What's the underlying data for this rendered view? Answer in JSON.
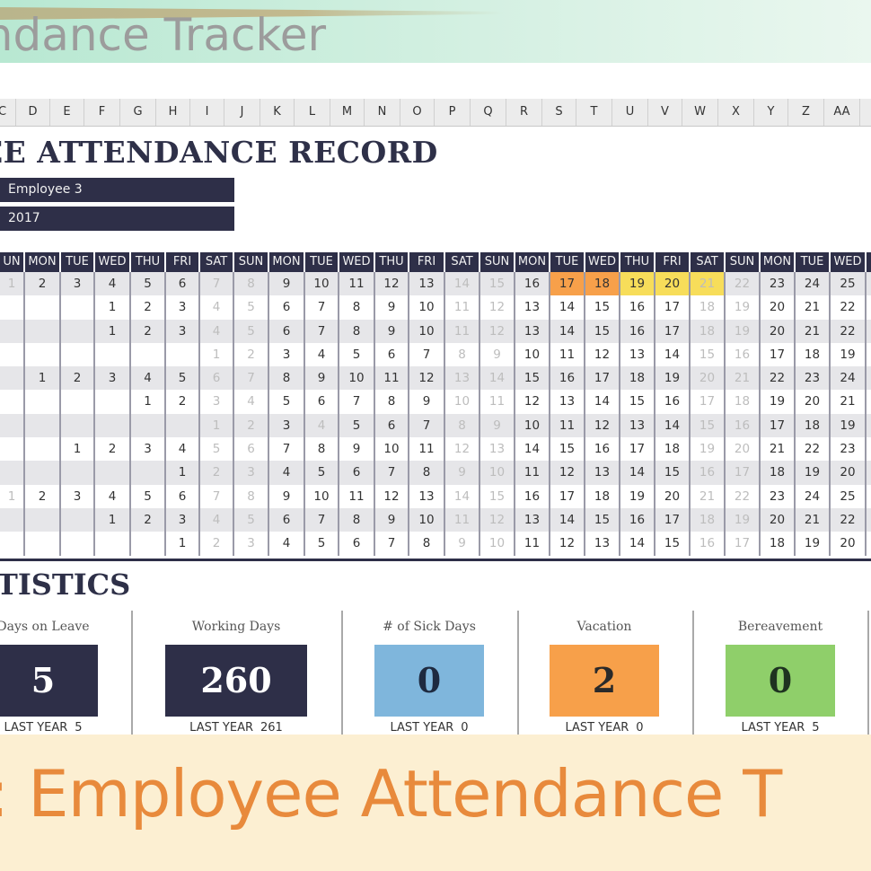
{
  "banner_top": {
    "title": "endance Tracker"
  },
  "column_letters": [
    "C",
    "D",
    "E",
    "F",
    "G",
    "H",
    "I",
    "J",
    "K",
    "L",
    "M",
    "N",
    "O",
    "P",
    "Q",
    "R",
    "S",
    "T",
    "U",
    "V",
    "W",
    "X",
    "Y",
    "Z",
    "AA"
  ],
  "record": {
    "title": "EE ATTENDANCE RECORD",
    "employee": "Employee 3",
    "year": "2017"
  },
  "calendar": {
    "day_headers": [
      "UN",
      "MON",
      "TUE",
      "WED",
      "THU",
      "FRI",
      "SAT",
      "SUN",
      "MON",
      "TUE",
      "WED",
      "THU",
      "FRI",
      "SAT",
      "SUN",
      "MON",
      "TUE",
      "WED",
      "THU",
      "FRI",
      "SAT",
      "SUN",
      "MON",
      "TUE",
      "WED"
    ],
    "weekend_columns": [
      0,
      6,
      7,
      13,
      14,
      20,
      21
    ],
    "rows": [
      [
        1,
        2,
        3,
        4,
        5,
        6,
        7,
        8,
        9,
        10,
        11,
        12,
        13,
        14,
        15,
        16,
        17,
        18,
        19,
        20,
        21,
        22,
        23,
        24,
        25
      ],
      [
        null,
        null,
        null,
        1,
        2,
        3,
        4,
        5,
        6,
        7,
        8,
        9,
        10,
        11,
        12,
        13,
        14,
        15,
        16,
        17,
        18,
        19,
        20,
        21,
        22
      ],
      [
        null,
        null,
        null,
        1,
        2,
        3,
        4,
        5,
        6,
        7,
        8,
        9,
        10,
        11,
        12,
        13,
        14,
        15,
        16,
        17,
        18,
        19,
        20,
        21,
        22
      ],
      [
        null,
        null,
        null,
        null,
        null,
        null,
        1,
        2,
        3,
        4,
        5,
        6,
        7,
        8,
        9,
        10,
        11,
        12,
        13,
        14,
        15,
        16,
        17,
        18,
        19
      ],
      [
        null,
        1,
        2,
        3,
        4,
        5,
        6,
        7,
        8,
        9,
        10,
        11,
        12,
        13,
        14,
        15,
        16,
        17,
        18,
        19,
        20,
        21,
        22,
        23,
        24
      ],
      [
        null,
        null,
        null,
        null,
        1,
        2,
        3,
        4,
        5,
        6,
        7,
        8,
        9,
        10,
        11,
        12,
        13,
        14,
        15,
        16,
        17,
        18,
        19,
        20,
        21
      ],
      [
        null,
        null,
        null,
        null,
        null,
        null,
        1,
        2,
        3,
        4,
        5,
        6,
        7,
        8,
        9,
        10,
        11,
        12,
        13,
        14,
        15,
        16,
        17,
        18,
        19
      ],
      [
        null,
        null,
        1,
        2,
        3,
        4,
        5,
        6,
        7,
        8,
        9,
        10,
        11,
        12,
        13,
        14,
        15,
        16,
        17,
        18,
        19,
        20,
        21,
        22,
        23
      ],
      [
        null,
        null,
        null,
        null,
        null,
        1,
        2,
        3,
        4,
        5,
        6,
        7,
        8,
        9,
        10,
        11,
        12,
        13,
        14,
        15,
        16,
        17,
        18,
        19,
        20
      ],
      [
        1,
        2,
        3,
        4,
        5,
        6,
        7,
        8,
        9,
        10,
        11,
        12,
        13,
        14,
        15,
        16,
        17,
        18,
        19,
        20,
        21,
        22,
        23,
        24,
        25
      ],
      [
        null,
        null,
        null,
        1,
        2,
        3,
        4,
        5,
        6,
        7,
        8,
        9,
        10,
        11,
        12,
        13,
        14,
        15,
        16,
        17,
        18,
        19,
        20,
        21,
        22
      ],
      [
        null,
        null,
        null,
        null,
        null,
        1,
        2,
        3,
        4,
        5,
        6,
        7,
        8,
        9,
        10,
        11,
        12,
        13,
        14,
        15,
        16,
        17,
        18,
        19,
        20
      ]
    ],
    "holidays": [
      {
        "row": 6,
        "col": 9
      }
    ],
    "highlights": [
      {
        "row": 0,
        "col": 16,
        "type": "vacation"
      },
      {
        "row": 0,
        "col": 17,
        "type": "vacation"
      },
      {
        "row": 0,
        "col": 18,
        "type": "personal"
      },
      {
        "row": 0,
        "col": 19,
        "type": "personal"
      },
      {
        "row": 0,
        "col": 20,
        "type": "personal"
      }
    ],
    "highlight_colors": {
      "vacation": "#f7a04a",
      "personal": "#f7dd5a"
    }
  },
  "statistics": {
    "title": "TISTICS",
    "cards": [
      {
        "label": "Days on Leave",
        "value": "5",
        "last_year_label": "LAST YEAR",
        "last_year": "5",
        "color": "#2e2f48",
        "text_color": "#ffffff"
      },
      {
        "label": "Working Days",
        "value": "260",
        "last_year_label": "LAST YEAR",
        "last_year": "261",
        "color": "#2e2f48",
        "text_color": "#ffffff"
      },
      {
        "label": "# of Sick Days",
        "value": "0",
        "last_year_label": "LAST YEAR",
        "last_year": "0",
        "color": "#7fb6dc",
        "text_color": "#1e2a40"
      },
      {
        "label": "Vacation",
        "value": "2",
        "last_year_label": "LAST YEAR",
        "last_year": "0",
        "color": "#f7a04a",
        "text_color": "#2a2a2a"
      },
      {
        "label": "Bereavement",
        "value": "0",
        "last_year_label": "LAST YEAR",
        "last_year": "5",
        "color": "#8fcf6a",
        "text_color": "#1f3320"
      }
    ]
  },
  "banner_bottom": {
    "text": ": Employee Attendance T"
  }
}
